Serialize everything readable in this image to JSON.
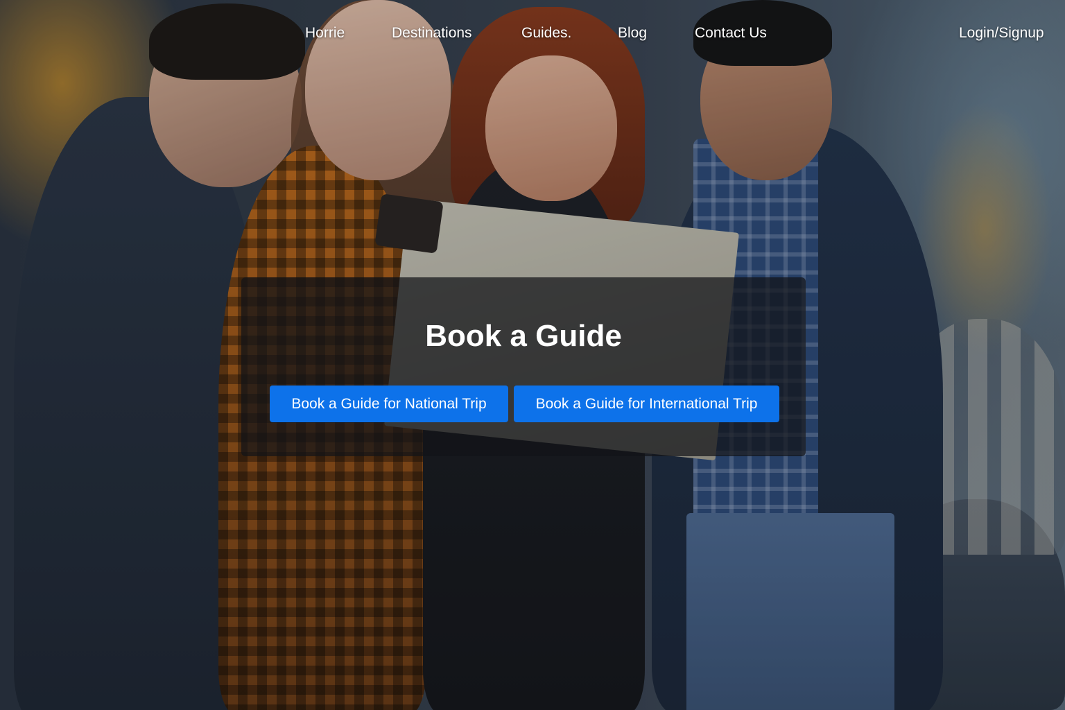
{
  "nav": {
    "items": [
      {
        "label": "Horrie"
      },
      {
        "label": "Destinations"
      },
      {
        "label": "Guides."
      },
      {
        "label": "Blog"
      },
      {
        "label": "Contact Us"
      }
    ],
    "login_label": "Login/Signup"
  },
  "hero": {
    "title": "Book a Guide",
    "buttons": {
      "national": "Book a Guide for National Trip",
      "international": "Book a Guide for International Trip"
    },
    "button_color": "#0d72ea",
    "background_image": "group-of-travelers-reading-map-photo"
  }
}
